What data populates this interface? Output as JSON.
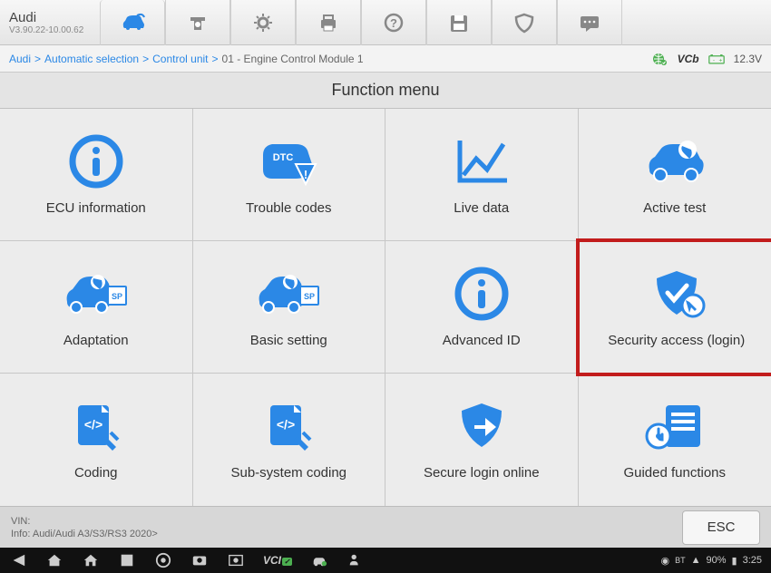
{
  "header": {
    "title": "Audi",
    "version": "V3.90.22-10.00.62"
  },
  "toolbar": [
    {
      "name": "car-diag-icon",
      "active": true
    },
    {
      "name": "service-icon",
      "active": false
    },
    {
      "name": "settings-icon",
      "active": false
    },
    {
      "name": "print-icon",
      "active": false
    },
    {
      "name": "help-icon",
      "active": false
    },
    {
      "name": "save-icon",
      "active": false
    },
    {
      "name": "shield-icon",
      "active": false
    },
    {
      "name": "chat-icon",
      "active": false
    }
  ],
  "breadcrumb": [
    "Audi",
    "Automatic selection",
    "Control unit",
    "01 - Engine Control Module 1"
  ],
  "status": {
    "voltage": "12.3V",
    "vci_label": "VCb"
  },
  "page": {
    "title": "Function menu"
  },
  "functions": [
    {
      "id": "ecu-info",
      "label": "ECU information",
      "icon": "info",
      "highlight": false
    },
    {
      "id": "trouble",
      "label": "Trouble codes",
      "icon": "dtc",
      "highlight": false
    },
    {
      "id": "live-data",
      "label": "Live data",
      "icon": "chart",
      "highlight": false
    },
    {
      "id": "active-test",
      "label": "Active test",
      "icon": "car-wrench",
      "highlight": false
    },
    {
      "id": "adaptation",
      "label": "Adaptation",
      "icon": "car-sp",
      "highlight": false
    },
    {
      "id": "basic",
      "label": "Basic setting",
      "icon": "car-sp",
      "highlight": false
    },
    {
      "id": "advanced",
      "label": "Advanced ID",
      "icon": "info",
      "highlight": false
    },
    {
      "id": "security",
      "label": "Security access (login)",
      "icon": "shield-click",
      "highlight": true
    },
    {
      "id": "coding",
      "label": "Coding",
      "icon": "code-doc",
      "highlight": false
    },
    {
      "id": "subsys",
      "label": "Sub-system coding",
      "icon": "code-doc",
      "highlight": false
    },
    {
      "id": "secure-login",
      "label": "Secure login online",
      "icon": "shield-arrow",
      "highlight": false
    },
    {
      "id": "guided",
      "label": "Guided functions",
      "icon": "list-hand",
      "highlight": false
    }
  ],
  "info": {
    "vin_label": "VIN:",
    "vin_value": "",
    "info_line": "Info: Audi/Audi A3/S3/RS3 2020>"
  },
  "esc": {
    "label": "ESC"
  },
  "bottom_status": {
    "battery": "90%",
    "time": "3:25"
  },
  "colors": {
    "accent": "#2b88e6",
    "highlight": "#c21c1c"
  }
}
